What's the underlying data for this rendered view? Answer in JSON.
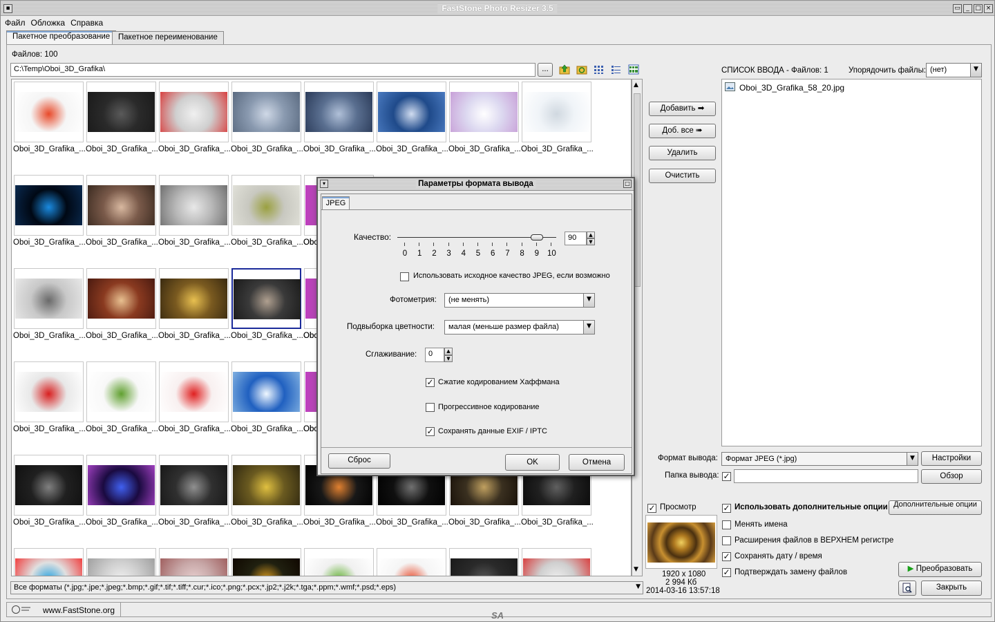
{
  "window": {
    "title": "FastStone Photo Resizer 3.5"
  },
  "menu": [
    "Файл",
    "Обложка",
    "Справка"
  ],
  "tabs": [
    "Пакетное преобразование",
    "Пакетное переименование"
  ],
  "files_count_label": "Файлов: 100",
  "path": "C:\\Temp\\Oboi_3D_Grafika\\",
  "browse_label": "...",
  "thumb_caption": "Oboi_3D_Grafika_...",
  "thumb_caption_cut": "Obo",
  "filter": "Все форматы (*.jpg;*.jpe;*.jpeg;*.bmp;*.gif;*.tif;*.tiff;*.cur;*.ico;*.png;*.pcx;*.jp2;*.j2k;*.tga;*.ppm;*.wmf;*.psd;*.eps)",
  "status_url": "www.FastStone.org",
  "watermark": "SA",
  "actions": {
    "add": "Добавить",
    "add_all": "Доб. все",
    "remove": "Удалить",
    "clear": "Очистить"
  },
  "input_list": {
    "title": "СПИСОК ВВОДА  -  Файлов: 1",
    "sort_label": "Упорядочить файлы:",
    "sort_value": "(нет)",
    "items": [
      "Oboi_3D_Grafika_58_20.jpg"
    ]
  },
  "output": {
    "format_label": "Формат вывода:",
    "format_value": "Формат JPEG (*.jpg)",
    "settings_button": "Настройки",
    "folder_label": "Папка вывода:",
    "folder_value": "",
    "browse_button": "Обзор"
  },
  "preview": {
    "label": "Просмотр",
    "dimensions": "1920 x 1080",
    "size": "2 994 Кб",
    "date": "2014-03-16 13:57:18"
  },
  "options": {
    "use_advanced": "Использовать дополнительные опции",
    "advanced_button": "Дополнительные опции",
    "rename": "Менять имена",
    "ext_upper": "Расширения файлов в ВЕРХНЕМ регистре",
    "keep_date": "Сохранять дату / время",
    "confirm_overwrite": "Подтверждать замену файлов",
    "convert_button": "Преобразовать",
    "close_button": "Закрыть"
  },
  "dialog": {
    "title": "Параметры формата вывода",
    "tab": "JPEG",
    "quality_label": "Качество:",
    "quality_value": "90",
    "quality_fraction": 0.9,
    "scale": [
      "0",
      "1",
      "2",
      "3",
      "4",
      "5",
      "6",
      "7",
      "8",
      "9",
      "10"
    ],
    "use_source_quality": "Использовать исходное качество JPEG, если возможно",
    "photometry_label": "Фотометрия:",
    "photometry_value": "(не менять)",
    "subsampling_label": "Подвыборка цветности:",
    "subsampling_value": "малая (меньше размер файла)",
    "smoothing_label": "Сглаживание:",
    "smoothing_value": "0",
    "huffman": "Сжатие кодированием Хаффмана",
    "progressive": "Прогрессивное кодирование",
    "keep_exif": "Сохранять данные EXIF / IPTC",
    "reset": "Сброс",
    "ok": "OK",
    "cancel": "Отмена"
  }
}
